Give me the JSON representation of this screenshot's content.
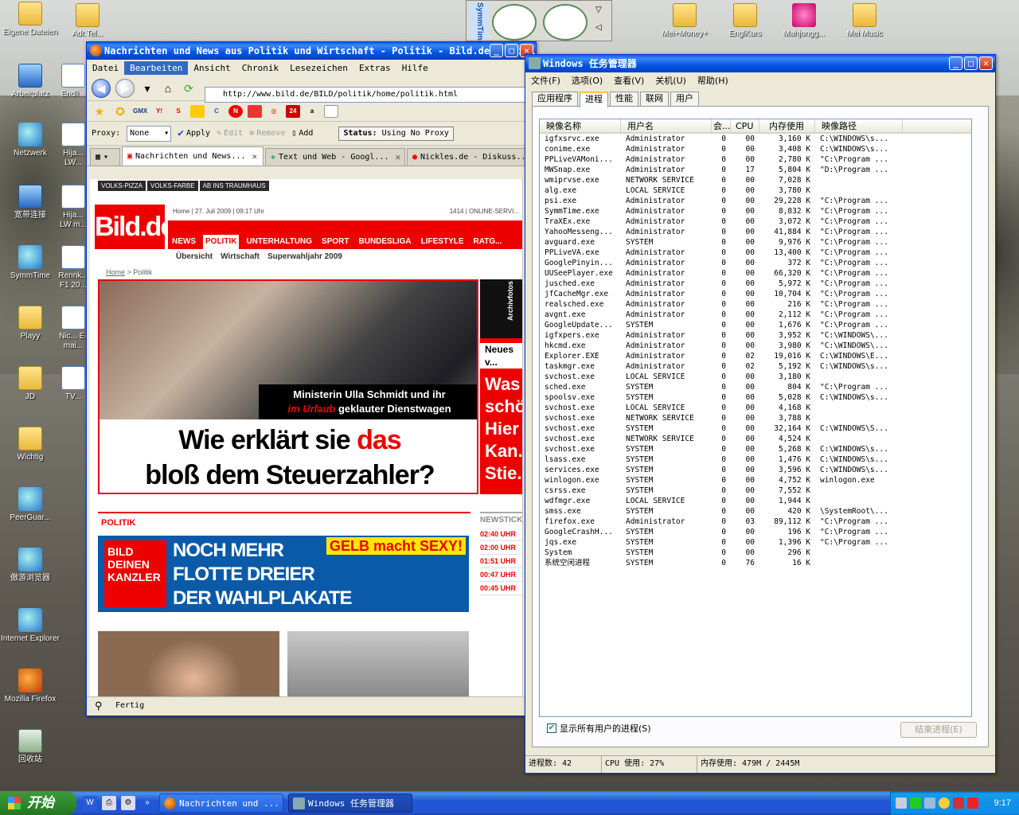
{
  "desktop": {
    "icons": [
      {
        "label": "Eigene Dateien",
        "icon": "folder-icon"
      },
      {
        "label": "Adr.Tel...",
        "icon": "folder-icon"
      },
      {
        "label": "Arbeitplatz",
        "icon": "computer-icon"
      },
      {
        "label": "Endli...",
        "icon": "doc-icon"
      },
      {
        "label": "Netzwerk",
        "icon": "network-icon"
      },
      {
        "label": "Hija... LW...",
        "icon": "doc-icon"
      },
      {
        "label": "宽带连接",
        "icon": "broadband-icon"
      },
      {
        "label": "Hija... LW m...",
        "icon": "doc-icon"
      },
      {
        "label": "SymmTime",
        "icon": "symmtime-icon"
      },
      {
        "label": "Rennk... F1 20...",
        "icon": "doc-icon"
      },
      {
        "label": "Playy",
        "icon": "folder-icon"
      },
      {
        "label": "Nic... E-mai...",
        "icon": "doc-icon"
      },
      {
        "label": "JD",
        "icon": "folder-icon"
      },
      {
        "label": "TV...",
        "icon": "doc-icon"
      },
      {
        "label": "Wichtig",
        "icon": "folder-icon"
      },
      {
        "label": "PeerGuar...",
        "icon": "peerguardian-icon"
      },
      {
        "label": "傲游浏览器",
        "icon": "maxthon-icon"
      },
      {
        "label": "Internet Explorer",
        "icon": "ie-icon"
      },
      {
        "label": "Mozilla Firefox",
        "icon": "firefox-icon"
      },
      {
        "label": "回收站",
        "icon": "recycle-bin-icon"
      },
      {
        "label": "Mei+Money+",
        "icon": "folder-icon"
      },
      {
        "label": "EnglKurs",
        "icon": "folder-icon"
      },
      {
        "label": "Mahjongg...",
        "icon": "mahjongg-icon"
      },
      {
        "label": "Mei Music",
        "icon": "folder-icon"
      }
    ],
    "gadget_label": "SymmTime"
  },
  "firefox": {
    "title": "Nachrichten und News aus Politik und Wirtschaft - Politik - Bild.de - Mozilla Firefox",
    "menu": [
      "Datei",
      "Bearbeiten",
      "Ansicht",
      "Chronik",
      "Lesezeichen",
      "Extras",
      "Hilfe"
    ],
    "active_menu": "Bearbeiten",
    "url": "http://www.bild.de/BILD/politik/home/politik.html",
    "bookmarks": [
      "GMX",
      "Y!",
      "S",
      "N",
      "24",
      "a"
    ],
    "proxy": {
      "label": "Proxy:",
      "value": "None",
      "apply": "Apply",
      "edit": "Edit",
      "remove": "Remove",
      "add": "Add",
      "status_label": "Status:",
      "status_value": "Using No Proxy"
    },
    "tabs": [
      {
        "label": "Nachrichten und News...",
        "selected": true
      },
      {
        "label": "Text und Web - Googl...",
        "selected": false
      },
      {
        "label": "Nickles.de - Diskuss...",
        "selected": false
      }
    ],
    "status": "Fertig"
  },
  "bild": {
    "promos": [
      "VOLKS-PIZZA",
      "VOLKS-FARBE",
      "AB INS TRAUMHAUS"
    ],
    "logo": "Bild.de",
    "dateline": "Home | 27. Juli 2009 | 09:17 Uhr",
    "online_service": "1414 | ONLINE-SERVI...",
    "nav": [
      "NEWS",
      "POLITIK",
      "UNTERHALTUNG",
      "SPORT",
      "BUNDESLIGA",
      "LIFESTYLE",
      "RATG..."
    ],
    "nav_active": "POLITIK",
    "subnav": [
      "Übersicht",
      "Wirtschaft",
      "Superwahljahr 2009"
    ],
    "breadcrumb_home": "Home",
    "breadcrumb_sep": " > ",
    "breadcrumb_current": "Politik",
    "hero_line1": "Ministerin Ulla Schmidt und ihr",
    "hero_line2_red": "im Urlaub",
    "hero_line2_rest": " geklauter Dienstwagen",
    "hero_big1": "Wie erklärt sie ",
    "hero_big1_red": "das",
    "hero_big2": "bloß dem Steuerzahler?",
    "side_neues": "Neues v...",
    "side_text1": "Was",
    "side_text2": "schö...",
    "side_text3": "Hier",
    "side_text4": "Kan...",
    "side_text5": "Stie...",
    "archiv": "Archivfotos",
    "section": "POLITIK",
    "banner_left": "BILD DEINEN KANZLER",
    "banner_line1": "NOCH MEHR",
    "banner_line2": "FLOTTE DREIER",
    "banner_line3": "DER WAHLPLAKATE",
    "banner_sexy": "GELB macht SEXY!",
    "newsticker": "NEWSTICK...",
    "ticker_times": [
      "02:40 UHR",
      "02:00 UHR",
      "01:51 UHR",
      "00:47 UHR",
      "00:45 UHR"
    ]
  },
  "taskmgr": {
    "title": "Windows 任务管理器",
    "menu": [
      "文件(F)",
      "选项(O)",
      "查看(V)",
      "关机(U)",
      "帮助(H)"
    ],
    "tabs": [
      "应用程序",
      "进程",
      "性能",
      "联网",
      "用户"
    ],
    "active_tab": "进程",
    "columns": [
      "映像名称",
      "用户名",
      "会...",
      "CPU",
      "内存使用",
      "映像路径"
    ],
    "rows": [
      [
        "igfxsrvc.exe",
        "Administrator",
        "0",
        "00",
        "3,160 K",
        "C:\\WINDOWS\\s..."
      ],
      [
        "conime.exe",
        "Administrator",
        "0",
        "00",
        "3,408 K",
        "C:\\WINDOWS\\s..."
      ],
      [
        "PPLiveVAMoni...",
        "Administrator",
        "0",
        "00",
        "2,780 K",
        "\"C:\\Program ..."
      ],
      [
        "MWSnap.exe",
        "Administrator",
        "0",
        "17",
        "5,804 K",
        "\"D:\\Program ..."
      ],
      [
        "wmiprvse.exe",
        "NETWORK SERVICE",
        "0",
        "00",
        "7,028 K",
        ""
      ],
      [
        "alg.exe",
        "LOCAL SERVICE",
        "0",
        "00",
        "3,780 K",
        ""
      ],
      [
        "psi.exe",
        "Administrator",
        "0",
        "00",
        "29,228 K",
        "\"C:\\Program ..."
      ],
      [
        "SymmTime.exe",
        "Administrator",
        "0",
        "00",
        "8,832 K",
        "\"C:\\Program ..."
      ],
      [
        "TraXEx.exe",
        "Administrator",
        "0",
        "00",
        "3,072 K",
        "\"C:\\Program ..."
      ],
      [
        "YahooMesseng...",
        "Administrator",
        "0",
        "00",
        "41,884 K",
        "\"C:\\Program ..."
      ],
      [
        "avguard.exe",
        "SYSTEM",
        "0",
        "00",
        "9,976 K",
        "\"C:\\Program ..."
      ],
      [
        "PPLiveVA.exe",
        "Administrator",
        "0",
        "00",
        "13,400 K",
        "\"C:\\Program ..."
      ],
      [
        "GooglePinyin...",
        "Administrator",
        "0",
        "00",
        "372 K",
        "\"C:\\Program ..."
      ],
      [
        "UUSeePlayer.exe",
        "Administrator",
        "0",
        "00",
        "66,320 K",
        "\"C:\\Program ..."
      ],
      [
        "jusched.exe",
        "Administrator",
        "0",
        "00",
        "5,972 K",
        "\"C:\\Program ..."
      ],
      [
        "jfCacheMgr.exe",
        "Administrator",
        "0",
        "00",
        "10,704 K",
        "\"C:\\Program ..."
      ],
      [
        "realsched.exe",
        "Administrator",
        "0",
        "00",
        "216 K",
        "\"C:\\Program ..."
      ],
      [
        "avgnt.exe",
        "Administrator",
        "0",
        "00",
        "2,112 K",
        "\"C:\\Program ..."
      ],
      [
        "GoogleUpdate...",
        "SYSTEM",
        "0",
        "00",
        "1,676 K",
        "\"C:\\Program ..."
      ],
      [
        "igfxpers.exe",
        "Administrator",
        "0",
        "00",
        "3,952 K",
        "\"C:\\WINDOWS\\..."
      ],
      [
        "hkcmd.exe",
        "Administrator",
        "0",
        "00",
        "3,980 K",
        "\"C:\\WINDOWS\\..."
      ],
      [
        "Explorer.EXE",
        "Administrator",
        "0",
        "02",
        "19,016 K",
        "C:\\WINDOWS\\E..."
      ],
      [
        "taskmgr.exe",
        "Administrator",
        "0",
        "02",
        "5,192 K",
        "C:\\WINDOWS\\s..."
      ],
      [
        "svchost.exe",
        "LOCAL SERVICE",
        "0",
        "00",
        "3,180 K",
        ""
      ],
      [
        "sched.exe",
        "SYSTEM",
        "0",
        "00",
        "804 K",
        "\"C:\\Program ..."
      ],
      [
        "spoolsv.exe",
        "SYSTEM",
        "0",
        "00",
        "5,028 K",
        "C:\\WINDOWS\\s..."
      ],
      [
        "svchost.exe",
        "LOCAL SERVICE",
        "0",
        "00",
        "4,168 K",
        ""
      ],
      [
        "svchost.exe",
        "NETWORK SERVICE",
        "0",
        "00",
        "3,788 K",
        ""
      ],
      [
        "svchost.exe",
        "SYSTEM",
        "0",
        "00",
        "32,164 K",
        "C:\\WINDOWS\\S..."
      ],
      [
        "svchost.exe",
        "NETWORK SERVICE",
        "0",
        "00",
        "4,524 K",
        ""
      ],
      [
        "svchost.exe",
        "SYSTEM",
        "0",
        "00",
        "5,268 K",
        "C:\\WINDOWS\\s..."
      ],
      [
        "lsass.exe",
        "SYSTEM",
        "0",
        "00",
        "1,476 K",
        "C:\\WINDOWS\\s..."
      ],
      [
        "services.exe",
        "SYSTEM",
        "0",
        "00",
        "3,596 K",
        "C:\\WINDOWS\\s..."
      ],
      [
        "winlogon.exe",
        "SYSTEM",
        "0",
        "00",
        "4,752 K",
        "winlogon.exe"
      ],
      [
        "csrss.exe",
        "SYSTEM",
        "0",
        "00",
        "7,552 K",
        ""
      ],
      [
        "wdfmgr.exe",
        "LOCAL SERVICE",
        "0",
        "00",
        "1,944 K",
        ""
      ],
      [
        "smss.exe",
        "SYSTEM",
        "0",
        "00",
        "420 K",
        "\\SystemRoot\\..."
      ],
      [
        "firefox.exe",
        "Administrator",
        "0",
        "03",
        "89,112 K",
        "\"C:\\Program ..."
      ],
      [
        "GoogleCrashH...",
        "SYSTEM",
        "0",
        "00",
        "196 K",
        "\"C:\\Program ..."
      ],
      [
        "jqs.exe",
        "SYSTEM",
        "0",
        "00",
        "1,396 K",
        "\"C:\\Program ..."
      ],
      [
        "System",
        "SYSTEM",
        "0",
        "00",
        "296 K",
        ""
      ],
      [
        "系统空闲进程",
        "SYSTEM",
        "0",
        "76",
        "16 K",
        ""
      ]
    ],
    "show_all_users": "显示所有用户的进程(S)",
    "end_process": "结束进程(E)",
    "status_processes": "进程数: 42",
    "status_cpu": "CPU 使用: 27%",
    "status_mem": "内存使用: 479M / 2445M"
  },
  "taskbar": {
    "start": "开始",
    "buttons": [
      {
        "label": "Nachrichten und ...",
        "icon": "firefox-icon"
      },
      {
        "label": "Windows 任务管理器",
        "icon": "taskmgr-icon"
      }
    ],
    "clock": "9:17",
    "quick_more": "»"
  }
}
